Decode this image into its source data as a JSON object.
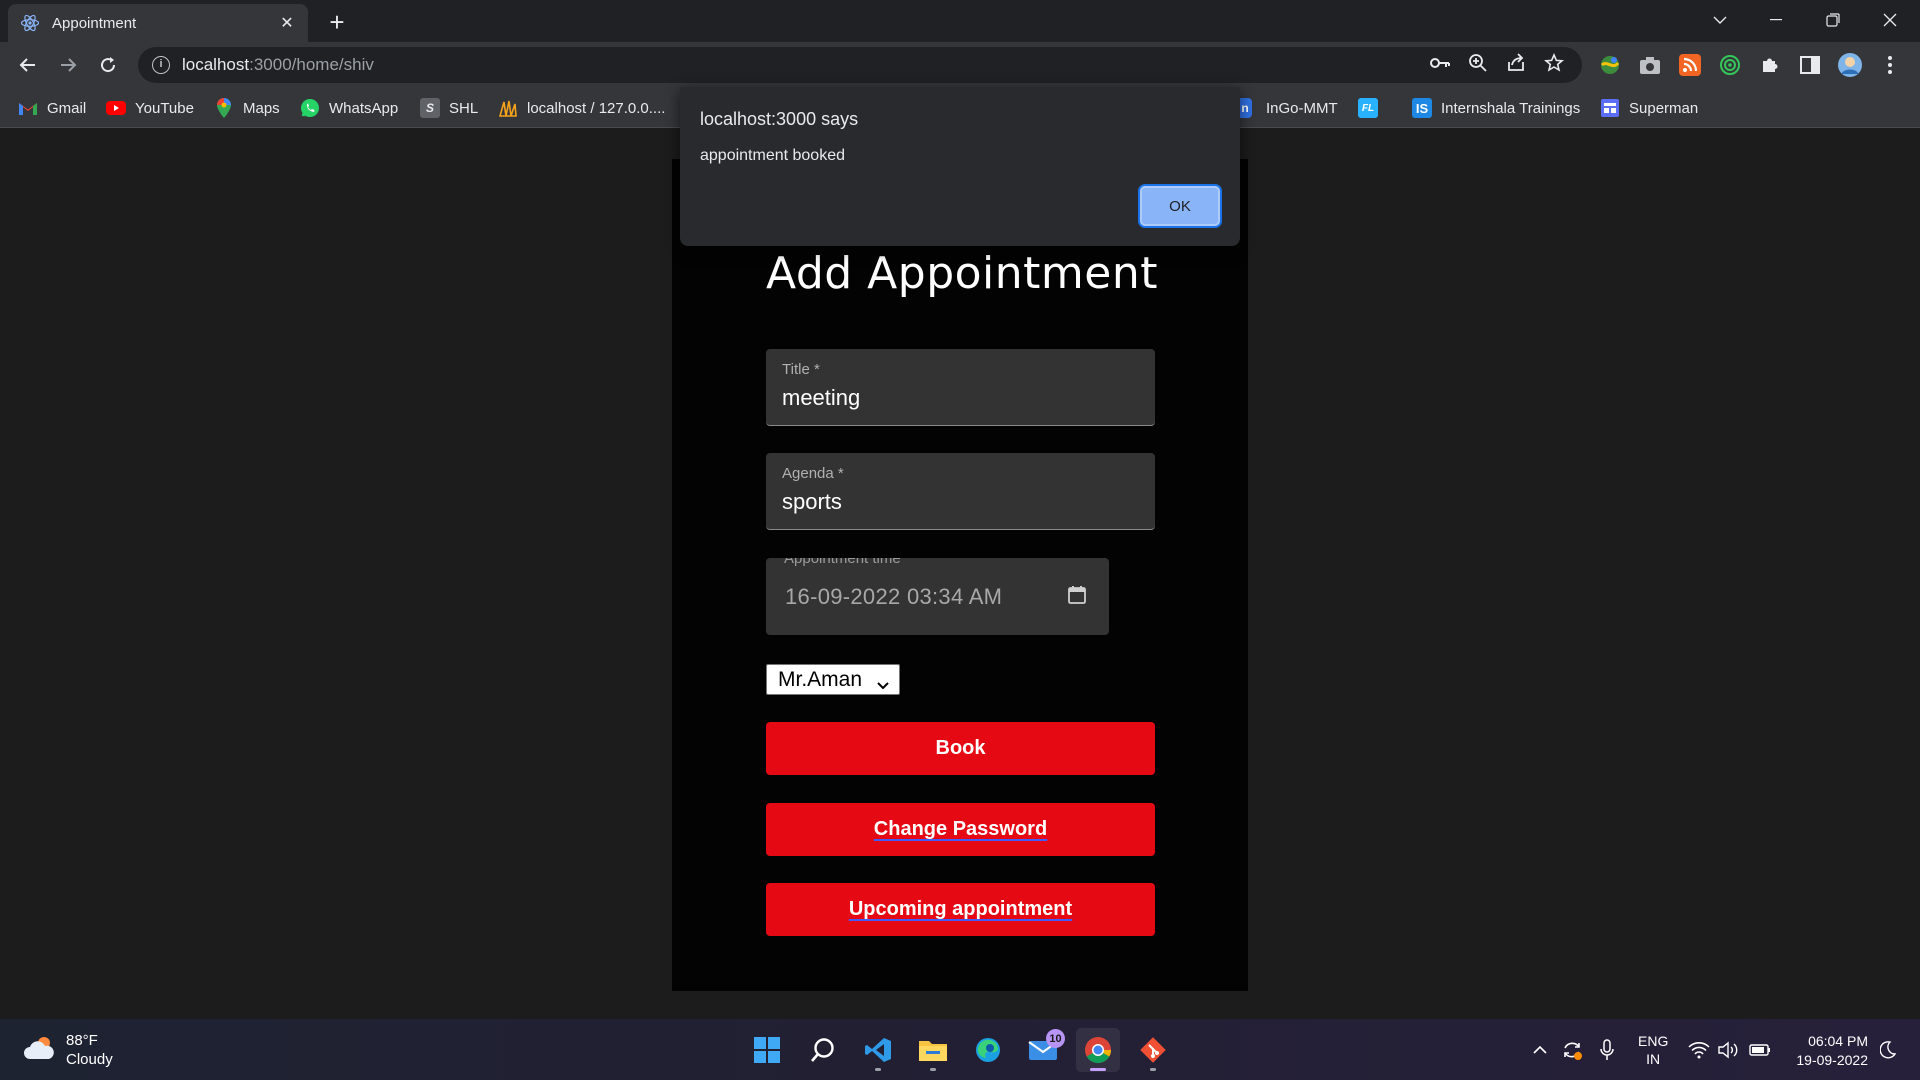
{
  "browser": {
    "tab_title": "Appointment",
    "url_host": "localhost",
    "url_path": ":3000/home/shiv",
    "bookmarks": [
      {
        "label": "Gmail",
        "icon": "gmail-icon"
      },
      {
        "label": "YouTube",
        "icon": "youtube-icon"
      },
      {
        "label": "Maps",
        "icon": "maps-icon"
      },
      {
        "label": "WhatsApp",
        "icon": "whatsapp-icon"
      },
      {
        "label": "SHL",
        "icon": "shl-icon"
      },
      {
        "label": "localhost / 127.0.0....",
        "icon": "phpmyadmin-icon"
      },
      {
        "label": "InGo-MMT",
        "icon": "ingo-icon"
      },
      {
        "label": "",
        "icon": "fl-icon"
      },
      {
        "label": "Internshala Trainings",
        "icon": "internshala-icon"
      },
      {
        "label": "Superman",
        "icon": "superman-icon"
      }
    ]
  },
  "dialog": {
    "title": "localhost:3000 says",
    "message": "appointment booked",
    "ok_label": "OK"
  },
  "form": {
    "heading": "Add Appointment",
    "title_label": "Title *",
    "title_value": "meeting",
    "agenda_label": "Agenda *",
    "agenda_value": "sports",
    "time_label": "Appointment time",
    "time_value": "16-09-2022 03:34  AM",
    "doctor_selected": "Mr.Aman",
    "book_label": "Book",
    "change_password_label": "Change Password",
    "upcoming_label": "Upcoming appointment"
  },
  "taskbar": {
    "temperature": "88°F",
    "condition": "Cloudy",
    "mail_badge": "10",
    "lang_line1": "ENG",
    "lang_line2": "IN",
    "time": "06:04 PM",
    "date": "19-09-2022"
  },
  "colors": {
    "accent_red": "#e50914",
    "dialog_ok": "#8ab4f8",
    "card_bg": "#030303",
    "field_bg": "#333333"
  }
}
